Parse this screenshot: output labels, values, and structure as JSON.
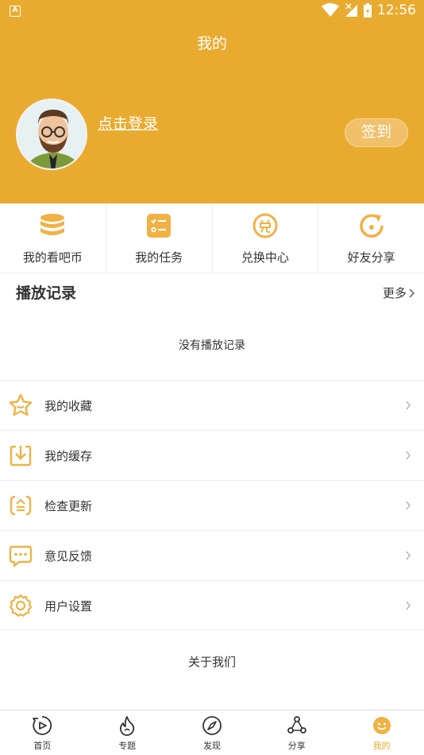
{
  "status_bar": {
    "app_badge": "A",
    "time": "12:56"
  },
  "header": {
    "title": "我的",
    "login_link": "点击登录",
    "signin_button": "签到"
  },
  "quick_actions": [
    {
      "label": "我的看吧币",
      "icon": "coins-stack-icon"
    },
    {
      "label": "我的任务",
      "icon": "task-list-icon"
    },
    {
      "label": "兑换中心",
      "icon": "exchange-coin-icon"
    },
    {
      "label": "好友分享",
      "icon": "share-refresh-icon"
    }
  ],
  "history": {
    "title": "播放记录",
    "more": "更多",
    "empty_text": "没有播放记录"
  },
  "menu": [
    {
      "label": "我的收藏",
      "icon": "star-icon"
    },
    {
      "label": "我的缓存",
      "icon": "download-icon"
    },
    {
      "label": "检查更新",
      "icon": "update-icon"
    },
    {
      "label": "意见反馈",
      "icon": "chat-bubble-icon"
    },
    {
      "label": "用户设置",
      "icon": "gear-icon"
    }
  ],
  "about": "关于我们",
  "bottom_nav": [
    {
      "label": "首页",
      "icon": "home-play-icon"
    },
    {
      "label": "专题",
      "icon": "flame-icon"
    },
    {
      "label": "发现",
      "icon": "compass-icon"
    },
    {
      "label": "分享",
      "icon": "share-nodes-icon"
    },
    {
      "label": "我的",
      "icon": "smiley-icon",
      "active": true
    }
  ],
  "colors": {
    "accent": "#e9ab2f",
    "icon_orange": "#f0b244"
  }
}
